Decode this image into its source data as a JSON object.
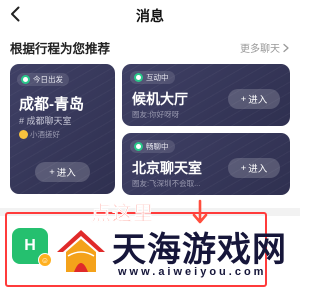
{
  "header": {
    "title": "消息"
  },
  "section": {
    "title": "根据行程为您推荐",
    "more": "更多聊天"
  },
  "cards": [
    {
      "badge": "今日出发",
      "title": "成都-青岛",
      "subtitle": "# 成都聊天室",
      "note": "小酒搓好",
      "button": "进入"
    },
    {
      "badge": "互动中",
      "title": "候机大厅",
      "note": "圈友:你好呀呀",
      "button": "进入"
    },
    {
      "badge": "畅聊中",
      "title": "北京聊天室",
      "note": "圈友:飞深圳不会取...",
      "button": "进入"
    }
  ],
  "overlay": {
    "callout": "点这里",
    "app_icon_text": "H"
  },
  "watermark": {
    "name": "天海游戏网",
    "url": "www.aiweiyou.com"
  },
  "colors": {
    "card_bg": "#3a3b5e",
    "callout_red": "#ff4d3d",
    "badge_green": "#28c88a",
    "app_green": "#25c06f"
  }
}
